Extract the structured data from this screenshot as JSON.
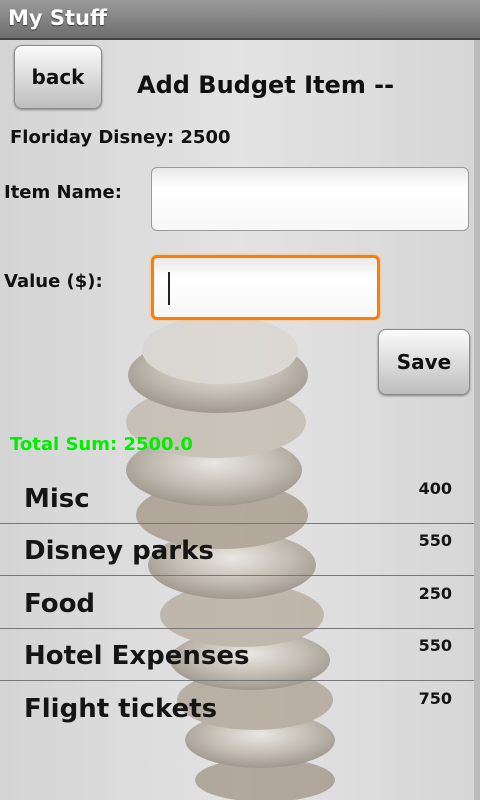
{
  "app": {
    "title": "My Stuff"
  },
  "header": {
    "back_label": "back",
    "page_title": "Add Budget Item --"
  },
  "budget": {
    "summary": "Floriday Disney: 2500"
  },
  "form": {
    "item_name_label": "Item Name:",
    "item_name_value": "",
    "value_label": "Value ($):",
    "value_value": "",
    "save_label": "Save"
  },
  "totals": {
    "total_text": "Total Sum: 2500.0",
    "total_color": "#00ee00"
  },
  "items": [
    {
      "name": "Misc",
      "value": "400"
    },
    {
      "name": "Disney parks",
      "value": "550"
    },
    {
      "name": "Food",
      "value": "250"
    },
    {
      "name": "Hotel Expenses",
      "value": "550"
    },
    {
      "name": "Flight tickets",
      "value": "750"
    }
  ]
}
